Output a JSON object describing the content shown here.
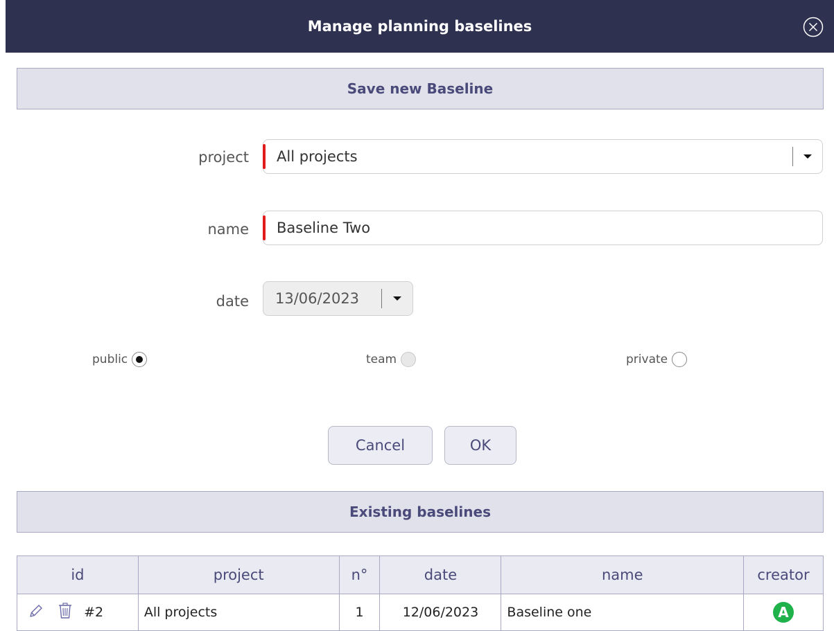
{
  "dialog": {
    "title": "Manage planning baselines"
  },
  "save_section": {
    "header": "Save new Baseline",
    "project_label": "project",
    "project_value": "All projects",
    "name_label": "name",
    "name_value": "Baseline Two",
    "date_label": "date",
    "date_value": "13/06/2023",
    "visibility": [
      {
        "label": "public",
        "checked": true,
        "disabled": false
      },
      {
        "label": "team",
        "checked": false,
        "disabled": true
      },
      {
        "label": "private",
        "checked": false,
        "disabled": false
      }
    ],
    "cancel_label": "Cancel",
    "ok_label": "OK"
  },
  "existing_section": {
    "header": "Existing baselines",
    "columns": [
      "id",
      "project",
      "n°",
      "date",
      "name",
      "creator"
    ],
    "rows": [
      {
        "id": "#2",
        "project": "All projects",
        "number": "1",
        "date": "12/06/2023",
        "name": "Baseline one",
        "creator_initial": "A"
      }
    ]
  },
  "colors": {
    "titlebar": "#2f3150",
    "header_bg": "#e1e1ec",
    "accent_text": "#4a4a7a",
    "required_marker": "#e21c1c",
    "avatar": "#1fb24a"
  }
}
